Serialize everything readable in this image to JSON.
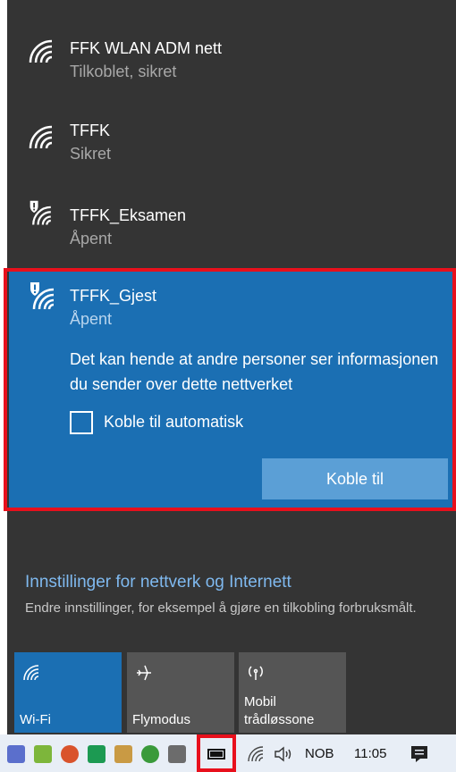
{
  "networks": [
    {
      "name": "FFK WLAN ADM nett",
      "status": "Tilkoblet, sikret",
      "icon": "wifi-icon"
    },
    {
      "name": "TFFK",
      "status": "Sikret",
      "icon": "wifi-icon"
    },
    {
      "name": "TFFK_Eksamen",
      "status": "Åpent",
      "icon": "wifi-open-warning-icon"
    }
  ],
  "selected_network": {
    "name": "TFFK_Gjest",
    "status": "Åpent",
    "icon": "wifi-open-warning-icon",
    "warning": "Det kan hende at andre personer ser informasjonen du sender over dette nettverket",
    "auto_connect_label": "Koble til automatisk",
    "auto_connect_checked": false,
    "connect_label": "Koble til"
  },
  "settings": {
    "link": "Innstillinger for nettverk og Internett",
    "description": "Endre innstillinger, for eksempel å gjøre en tilkobling forbruksmålt."
  },
  "quick_actions": [
    {
      "label": "Wi-Fi",
      "icon": "wifi-icon",
      "active": true
    },
    {
      "label": "Flymodus",
      "icon": "airplane-icon",
      "active": false
    },
    {
      "label": "Mobil trådløssone",
      "icon": "hotspot-icon",
      "active": false
    }
  ],
  "taskbar": {
    "language": "NOB",
    "time": "11:05"
  },
  "colors": {
    "accent": "#1b6fb3",
    "flyout_bg": "#343434",
    "highlight": "#e8101c",
    "link": "#7fb9ef"
  }
}
